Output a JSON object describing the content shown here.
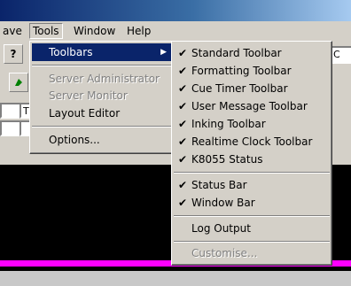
{
  "menubar": {
    "items": [
      {
        "label": "ave"
      },
      {
        "label": "Tools"
      },
      {
        "label": "Window"
      },
      {
        "label": "Help"
      }
    ]
  },
  "toolbar": {
    "help_glyph": "?",
    "combo_left_text": "Ti",
    "combo_right_text": "C"
  },
  "tools_menu": {
    "items": [
      {
        "label": "Toolbars",
        "state": "highlighted",
        "submenu": true
      },
      {
        "label": "Server Administrator",
        "state": "disabled"
      },
      {
        "label": "Server Monitor",
        "state": "disabled"
      },
      {
        "label": "Layout Editor",
        "state": "enabled"
      },
      {
        "label": "Options...",
        "state": "enabled"
      }
    ]
  },
  "toolbars_submenu": {
    "items": [
      {
        "label": "Standard Toolbar",
        "checked": true
      },
      {
        "label": "Formatting Toolbar",
        "checked": true
      },
      {
        "label": "Cue Timer Toolbar",
        "checked": true
      },
      {
        "label": "User Message Toolbar",
        "checked": true
      },
      {
        "label": "Inking Toolbar",
        "checked": true
      },
      {
        "label": "Realtime Clock Toolbar",
        "checked": true
      },
      {
        "label": "K8055 Status",
        "checked": true
      },
      {
        "label": "Status Bar",
        "checked": true
      },
      {
        "label": "Window Bar",
        "checked": true
      },
      {
        "label": "Log Output",
        "checked": false
      },
      {
        "label": "Customise...",
        "checked": false,
        "disabled": true
      }
    ]
  },
  "colors": {
    "highlight": "#0a246a",
    "window_bg": "#d4d0c8",
    "workspace": "#000000",
    "accent_line": "#ff00ff"
  },
  "icons": {
    "check": "✔",
    "submenu_arrow": "▶"
  }
}
